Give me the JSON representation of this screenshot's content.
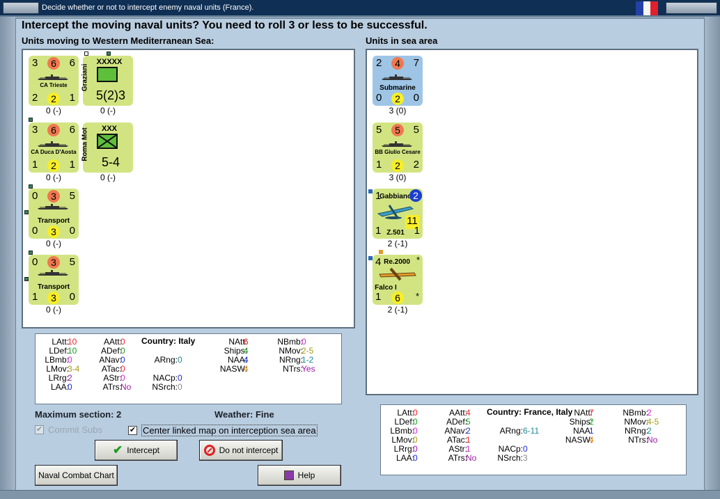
{
  "window": {
    "title": "Decide whether or not to intercept enemy naval units (France).",
    "flag_colors": [
      "#2440a8",
      "#f5f5f5",
      "#e0202c"
    ]
  },
  "main_heading": "Intercept the moving naval units?  You need to roll 3 or less to be successful.",
  "left_heading": "Units moving to Western Mediterranean Sea:",
  "right_heading": "Units in sea area",
  "moving_units": [
    {
      "kind": "ship",
      "name": "CA Trieste",
      "top_left": "3",
      "top_mid": "6",
      "top_right": "6",
      "bot_left": "2",
      "bot_mid": "2",
      "bot_right": "1",
      "under": "0 (-)"
    },
    {
      "kind": "land",
      "name": "Graziani",
      "size": "XXXXX",
      "strength": "5(2)3",
      "under": "0 (-)"
    },
    {
      "kind": "ship",
      "name": "CA Duca D'Aosta",
      "top_left": "3",
      "top_mid": "6",
      "top_right": "6",
      "bot_left": "1",
      "bot_mid": "2",
      "bot_right": "1",
      "under": "0 (-)"
    },
    {
      "kind": "land",
      "name": "Roma Mot",
      "size": "XXX",
      "strength": "5-4",
      "under": "0 (-)"
    },
    {
      "kind": "transport",
      "name": "Transport",
      "top_left": "0",
      "top_mid": "3",
      "top_right": "5",
      "bot_left": "0",
      "bot_mid": "3",
      "bot_right": "0",
      "under": "0 (-)"
    },
    {
      "kind": "transport",
      "name": "Transport",
      "top_left": "0",
      "top_mid": "3",
      "top_right": "5",
      "bot_left": "1",
      "bot_mid": "3",
      "bot_right": "0",
      "under": "0 (-)"
    }
  ],
  "sea_units": [
    {
      "kind": "sub",
      "name": "Submarine",
      "top_left": "2",
      "top_mid": "4",
      "top_right": "7",
      "bot_left": "0",
      "bot_mid": "2",
      "bot_right": "0",
      "under": "3 (0)"
    },
    {
      "kind": "ship",
      "name": "BB Giulio Cesare",
      "top_left": "5",
      "top_mid": "5",
      "top_right": "5",
      "bot_left": "1",
      "bot_mid": "2",
      "bot_right": "2",
      "under": "3 (0)"
    },
    {
      "kind": "air",
      "name": "Gabbiano",
      "sub": "Z.501",
      "top_left": "1",
      "badge": "2",
      "bot_left": "1",
      "bot_mid": "11",
      "bot_right": "1",
      "under": "2 (-1)"
    },
    {
      "kind": "air2",
      "name": "Re.2000",
      "sub": "Falco I",
      "top_left": "4",
      "star": "*",
      "bot_left": "1",
      "bot_mid": "6",
      "bot_right": "*",
      "under": "2 (-1)"
    }
  ],
  "left_stats": {
    "LAtt": "10",
    "LDef": "10",
    "LBmb": "0",
    "LMov": "3-4",
    "LRrg": "2",
    "LAA": "0",
    "AAtt": "0",
    "ADef": "0",
    "ANav": "0",
    "ATac": "0",
    "AStr": "0",
    "ATrs": "No",
    "country_label": "Country:",
    "country": "Italy",
    "ARng": "0",
    "NACp": "0",
    "NSrch": "0",
    "NAtt": "6",
    "Ships": "4",
    "NAA": "4",
    "NASW": "4",
    "NBmb": "0",
    "NMov": "2-5",
    "NRng": "1-2",
    "NTrs": "Yes"
  },
  "right_stats": {
    "LAtt": "0",
    "LDef": "0",
    "LBmb": "0",
    "LMov": "0",
    "LRrg": "0",
    "LAA": "0",
    "AAtt": "4",
    "ADef": "5",
    "ANav": "2",
    "ATac": "1",
    "AStr": "1",
    "ATrs": "No",
    "country_label": "Country:",
    "country": "France, Italy",
    "ARng": "6-11",
    "NACp": "0",
    "NSrch": "3",
    "NAtt": "7",
    "Ships": "2",
    "NAA": "1",
    "NASW": "4",
    "NBmb": "2",
    "NMov": "4-5",
    "NRng": "2",
    "NTrs": "No"
  },
  "max_section": "Maximum section: 2",
  "weather": "Weather:  Fine",
  "commit_subs": "Commit Subs",
  "center_map": "Center linked map on interception sea area",
  "buttons": {
    "intercept": "Intercept",
    "no_intercept": "Do not intercept",
    "chart": "Naval Combat Chart",
    "help": "Help"
  }
}
